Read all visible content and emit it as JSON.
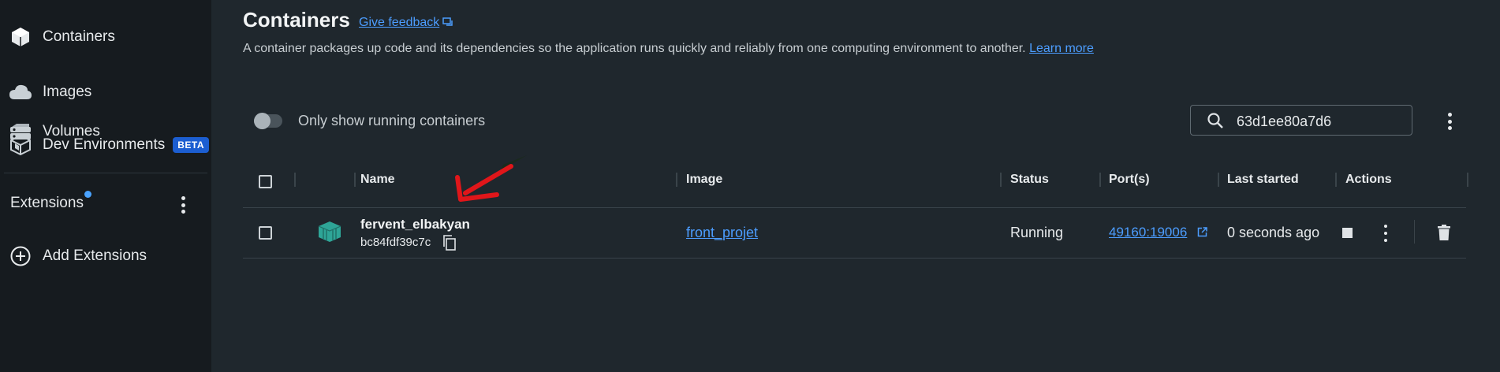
{
  "sidebar": {
    "items": [
      {
        "label": "Containers",
        "icon": "container-cube-icon"
      },
      {
        "label": "Images",
        "icon": "cloud-icon"
      },
      {
        "label": "Volumes",
        "icon": "database-icon"
      },
      {
        "label": "Dev Environments",
        "icon": "dev-env-cube-icon",
        "badge": "BETA"
      }
    ],
    "extensions_label": "Extensions",
    "add_extensions_label": "Add Extensions"
  },
  "header": {
    "title": "Containers",
    "feedback_label": "Give feedback",
    "description": "A container packages up code and its dependencies so the application runs quickly and reliably from one computing environment to another.",
    "learn_more": "Learn more"
  },
  "filter": {
    "toggle_label": "Only show running containers",
    "toggle_on": false
  },
  "search": {
    "value": "63d1ee80a7d6"
  },
  "table": {
    "headers": {
      "name": "Name",
      "image": "Image",
      "status": "Status",
      "ports": "Port(s)",
      "last_started": "Last started",
      "actions": "Actions"
    },
    "rows": [
      {
        "name": "fervent_elbakyan",
        "id": "bc84fdf39c7c",
        "image": "front_projet",
        "status": "Running",
        "ports": "49160:19006",
        "last_started": "0 seconds ago"
      }
    ]
  },
  "colors": {
    "accent": "#4c9dff",
    "badge": "#1c5ed1",
    "container_icon": "#2ea597",
    "annotation_arrow": "#e0161a"
  }
}
